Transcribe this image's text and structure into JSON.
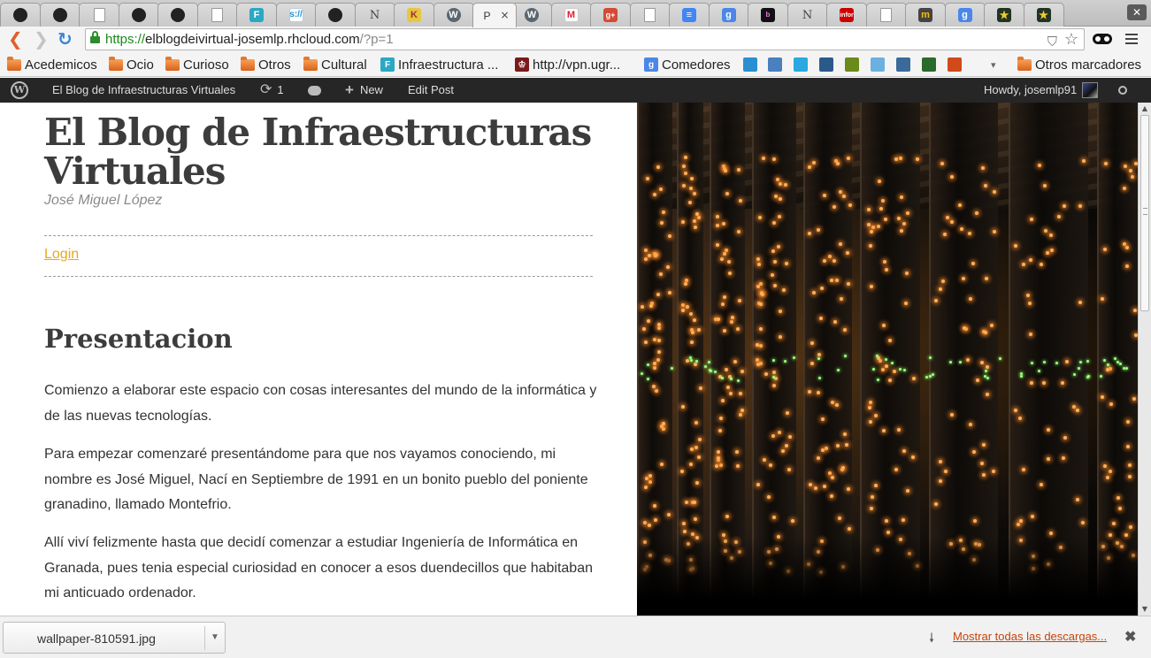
{
  "browser": {
    "tabs": [
      {
        "icon": "github-icon",
        "glyph": ""
      },
      {
        "icon": "github-icon",
        "glyph": ""
      },
      {
        "icon": "document-icon",
        "glyph": ""
      },
      {
        "icon": "github-icon",
        "glyph": ""
      },
      {
        "icon": "github-icon",
        "glyph": ""
      },
      {
        "icon": "document-icon",
        "glyph": ""
      },
      {
        "icon": "fw-icon",
        "glyph": "F"
      },
      {
        "icon": "link-icon",
        "glyph": "s://"
      },
      {
        "icon": "github-icon",
        "glyph": ""
      },
      {
        "icon": "n-icon",
        "glyph": "N"
      },
      {
        "icon": "kh-icon",
        "glyph": "K"
      },
      {
        "icon": "wordpress-icon",
        "glyph": "W"
      },
      {
        "icon": "wordpress-icon",
        "glyph": "W"
      },
      {
        "icon": "gmail-icon",
        "glyph": "M"
      },
      {
        "icon": "google-plus-icon",
        "glyph": "g+"
      },
      {
        "icon": "document-icon",
        "glyph": ""
      },
      {
        "icon": "google-docs-icon",
        "glyph": "≡"
      },
      {
        "icon": "google-icon",
        "glyph": "g"
      },
      {
        "icon": "book-icon",
        "glyph": "b"
      },
      {
        "icon": "n-icon",
        "glyph": "N"
      },
      {
        "icon": "infor-icon",
        "glyph": "infor"
      },
      {
        "icon": "document-icon",
        "glyph": ""
      },
      {
        "icon": "picture-icon",
        "glyph": "m"
      },
      {
        "icon": "google-icon",
        "glyph": "g"
      },
      {
        "icon": "star-icon",
        "glyph": "★"
      },
      {
        "icon": "star-icon",
        "glyph": "★"
      }
    ],
    "active_tab": {
      "title": "P",
      "close": "×"
    },
    "window_close": "✕",
    "back": "❮",
    "forward": "❯",
    "reload": "↻",
    "url": {
      "scheme": "https://",
      "host": "elblogdeivirtual-josemlp.rhcloud.com",
      "path": "/?p=1"
    },
    "bookmarks": [
      {
        "type": "folder",
        "label": "Acedemicos"
      },
      {
        "type": "folder",
        "label": "Ocio"
      },
      {
        "type": "folder",
        "label": "Curioso"
      },
      {
        "type": "folder",
        "label": "Otros"
      },
      {
        "type": "folder",
        "label": "Cultural"
      },
      {
        "type": "link",
        "label": "Infraestructura ...",
        "icon": "fw-icon",
        "color": "#2aa8c4"
      },
      {
        "type": "link",
        "label": "http://vpn.ugr...",
        "icon": "ugr-icon",
        "color": "#7a1a1a"
      },
      {
        "type": "link",
        "label": "Comedores",
        "icon": "google-icon",
        "color": "#4a87e8"
      }
    ],
    "bookmark_icons": [
      {
        "icon": "circle-icon",
        "color": "#2a8fd0"
      },
      {
        "icon": "rss-icon",
        "color": "#4a7fc0"
      },
      {
        "icon": "twitter-icon",
        "color": "#2aa8e0"
      },
      {
        "icon": "bird-icon",
        "color": "#2b5a8a"
      },
      {
        "icon": "z-icon",
        "color": "#6a8a1a"
      },
      {
        "icon": "moon-icon",
        "color": "#6ab0e0"
      },
      {
        "icon": "v-icon",
        "color": "#3a6a9a"
      },
      {
        "icon": "grid-icon",
        "color": "#2a6a2a"
      },
      {
        "icon": "leaf-icon",
        "color": "#d04a1a"
      }
    ],
    "bookmarks_more": "▾",
    "other_bookmarks": "Otros marcadores"
  },
  "adminbar": {
    "site_name": "El Blog de Infraestructuras Virtuales",
    "updates": "1",
    "new_label": "New",
    "edit_label": "Edit Post",
    "howdy": "Howdy, josemlp91"
  },
  "site": {
    "title": "El Blog de Infraestructuras Virtuales",
    "description": "José Miguel López",
    "login": "Login"
  },
  "post": {
    "title": "Presentacion",
    "paragraphs": [
      "Comienzo a elaborar este espacio con cosas interesantes del mundo de la informática y de las nuevas tecnologías.",
      "Para empezar comenzaré presentándome para que nos vayamos conociendo, mi nombre es José Miguel,  Nací en Septiembre de 1991 en un bonito pueblo del poniente granadino, llamado Montefrio.",
      "Allí viví felizmente  hasta que decidí comenzar a estudiar Ingeniería de Informática en Granada,  pues tenia especial curiosidad en conocer a esos duendecillos que habitaban mi anticuado ordenador."
    ]
  },
  "downloads": {
    "file": "wallpaper-810591.jpg",
    "show_all": "Mostrar todas las descargas...",
    "close": "✖"
  }
}
